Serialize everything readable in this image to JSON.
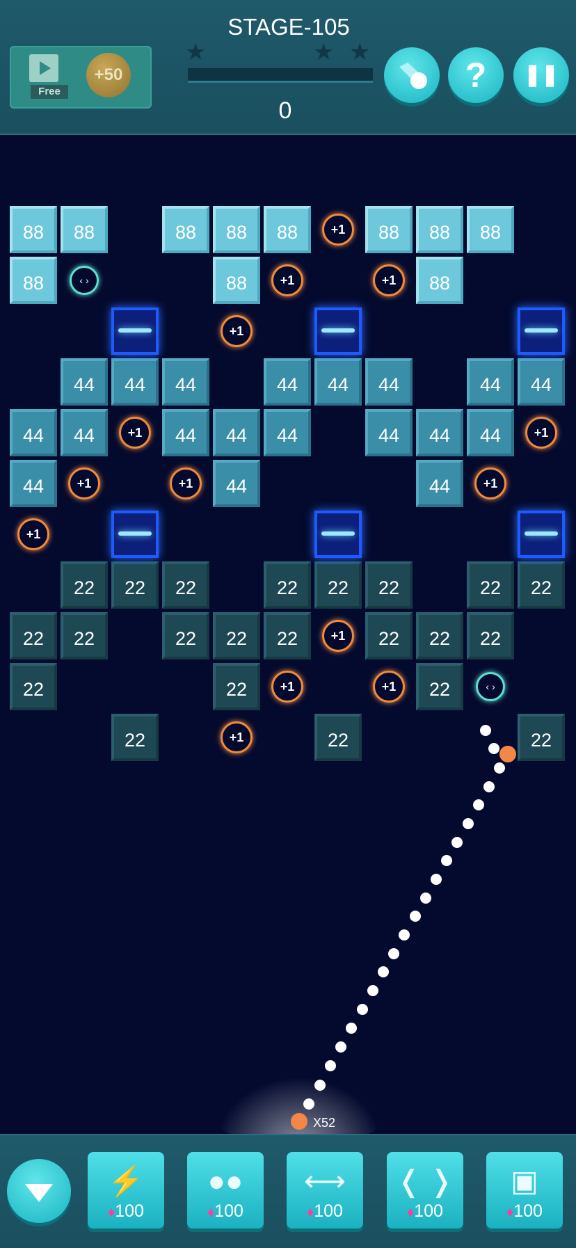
{
  "header": {
    "free_label": "Free",
    "bonus_label": "+50",
    "stage_title": "STAGE-105",
    "score": "0",
    "stars_earned": 0
  },
  "buttons": {
    "help_glyph": "?",
    "pause_glyph": "❚❚"
  },
  "board": {
    "bricks": [
      {
        "col": 0,
        "row": 0,
        "v": "88"
      },
      {
        "col": 1,
        "row": 0,
        "v": "88"
      },
      {
        "col": 3,
        "row": 0,
        "v": "88"
      },
      {
        "col": 4,
        "row": 0,
        "v": "88"
      },
      {
        "col": 5,
        "row": 0,
        "v": "88"
      },
      {
        "col": 7,
        "row": 0,
        "v": "88"
      },
      {
        "col": 8,
        "row": 0,
        "v": "88"
      },
      {
        "col": 9,
        "row": 0,
        "v": "88"
      },
      {
        "col": 0,
        "row": 1,
        "v": "88"
      },
      {
        "col": 4,
        "row": 1,
        "v": "88"
      },
      {
        "col": 8,
        "row": 1,
        "v": "88"
      },
      {
        "col": 1,
        "row": 3,
        "v": "44"
      },
      {
        "col": 2,
        "row": 3,
        "v": "44"
      },
      {
        "col": 3,
        "row": 3,
        "v": "44"
      },
      {
        "col": 5,
        "row": 3,
        "v": "44"
      },
      {
        "col": 6,
        "row": 3,
        "v": "44"
      },
      {
        "col": 7,
        "row": 3,
        "v": "44"
      },
      {
        "col": 9,
        "row": 3,
        "v": "44"
      },
      {
        "col": 10,
        "row": 3,
        "v": "44"
      },
      {
        "col": 0,
        "row": 4,
        "v": "44"
      },
      {
        "col": 1,
        "row": 4,
        "v": "44"
      },
      {
        "col": 3,
        "row": 4,
        "v": "44"
      },
      {
        "col": 4,
        "row": 4,
        "v": "44"
      },
      {
        "col": 5,
        "row": 4,
        "v": "44"
      },
      {
        "col": 7,
        "row": 4,
        "v": "44"
      },
      {
        "col": 8,
        "row": 4,
        "v": "44"
      },
      {
        "col": 9,
        "row": 4,
        "v": "44"
      },
      {
        "col": 0,
        "row": 5,
        "v": "44"
      },
      {
        "col": 4,
        "row": 5,
        "v": "44"
      },
      {
        "col": 8,
        "row": 5,
        "v": "44"
      },
      {
        "col": 1,
        "row": 7,
        "v": "22"
      },
      {
        "col": 2,
        "row": 7,
        "v": "22"
      },
      {
        "col": 3,
        "row": 7,
        "v": "22"
      },
      {
        "col": 5,
        "row": 7,
        "v": "22"
      },
      {
        "col": 6,
        "row": 7,
        "v": "22"
      },
      {
        "col": 7,
        "row": 7,
        "v": "22"
      },
      {
        "col": 9,
        "row": 7,
        "v": "22"
      },
      {
        "col": 10,
        "row": 7,
        "v": "22"
      },
      {
        "col": 0,
        "row": 8,
        "v": "22"
      },
      {
        "col": 1,
        "row": 8,
        "v": "22"
      },
      {
        "col": 3,
        "row": 8,
        "v": "22"
      },
      {
        "col": 4,
        "row": 8,
        "v": "22"
      },
      {
        "col": 5,
        "row": 8,
        "v": "22"
      },
      {
        "col": 7,
        "row": 8,
        "v": "22"
      },
      {
        "col": 8,
        "row": 8,
        "v": "22"
      },
      {
        "col": 9,
        "row": 8,
        "v": "22"
      },
      {
        "col": 0,
        "row": 9,
        "v": "22"
      },
      {
        "col": 4,
        "row": 9,
        "v": "22"
      },
      {
        "col": 8,
        "row": 9,
        "v": "22"
      },
      {
        "col": 2,
        "row": 10,
        "v": "22"
      },
      {
        "col": 6,
        "row": 10,
        "v": "22"
      },
      {
        "col": 10,
        "row": 10,
        "v": "22"
      }
    ],
    "plus_label": "+1",
    "plus_cells": [
      {
        "col": 6,
        "row": 0
      },
      {
        "col": 5,
        "row": 1
      },
      {
        "col": 7,
        "row": 1
      },
      {
        "col": 4,
        "row": 2
      },
      {
        "col": 2,
        "row": 4
      },
      {
        "col": 10,
        "row": 4
      },
      {
        "col": 1,
        "row": 5
      },
      {
        "col": 3,
        "row": 5
      },
      {
        "col": 9,
        "row": 5
      },
      {
        "col": 0,
        "row": 6
      },
      {
        "col": 6,
        "row": 8
      },
      {
        "col": 5,
        "row": 9
      },
      {
        "col": 7,
        "row": 9
      },
      {
        "col": 4,
        "row": 10
      }
    ],
    "spread_glyph": "‹ ›",
    "spread_cells": [
      {
        "col": 1,
        "row": 1
      },
      {
        "col": 9,
        "row": 9
      }
    ],
    "laser_cells": [
      {
        "col": 2,
        "row": 2
      },
      {
        "col": 6,
        "row": 2
      },
      {
        "col": 10,
        "row": 2
      },
      {
        "col": 2,
        "row": 6
      },
      {
        "col": 6,
        "row": 6
      },
      {
        "col": 10,
        "row": 6
      }
    ]
  },
  "ball_count": "X52",
  "toolbar": {
    "tools": [
      {
        "icon": "break-brick-icon",
        "glyph": "⚡",
        "price": "100"
      },
      {
        "icon": "multi-ball-icon",
        "glyph": "●●",
        "price": "100"
      },
      {
        "icon": "horizontal-laser-icon",
        "glyph": "⟷",
        "price": "100"
      },
      {
        "icon": "side-walls-icon",
        "glyph": "❬ ❭",
        "price": "100"
      },
      {
        "icon": "bottom-wall-icon",
        "glyph": "▣",
        "price": "100"
      }
    ]
  },
  "colors": {
    "accent": "#1ab4c2",
    "background": "#040a2e",
    "brick_88": "#6ec8dc",
    "brick_44": "#3a8ea7",
    "brick_22": "#1e4854",
    "plus_ring": "#f08a3c",
    "gem": "#ff3ba3"
  }
}
